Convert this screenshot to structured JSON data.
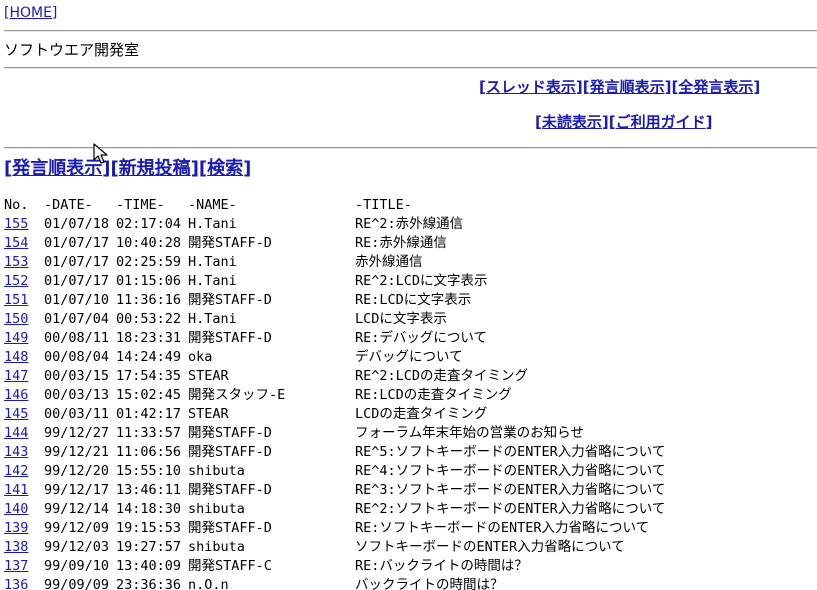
{
  "home": {
    "label": "[HOME]"
  },
  "board_title": "ソフトウエア開発室",
  "top_nav": {
    "row1": [
      "スレッド表示",
      "発言順表示",
      "全発言表示"
    ],
    "row2": [
      "未読表示",
      "ご利用ガイド"
    ]
  },
  "sub_nav": [
    "発言順表示",
    "新規投稿",
    "検索"
  ],
  "brackets": {
    "open": "[",
    "close": "]",
    "sep": "]["
  },
  "list": {
    "headers": {
      "no": "No.",
      "date": "-DATE-",
      "time": "-TIME-",
      "name": "-NAME-",
      "title": "-TITLE-"
    },
    "rows": [
      {
        "no": "155",
        "date": "01/07/18",
        "time": "02:17:04",
        "name": "H.Tani",
        "title": "RE^2:赤外線通信"
      },
      {
        "no": "154",
        "date": "01/07/17",
        "time": "10:40:28",
        "name": "開発STAFF-D",
        "title": "RE:赤外線通信"
      },
      {
        "no": "153",
        "date": "01/07/17",
        "time": "02:25:59",
        "name": "H.Tani",
        "title": "赤外線通信"
      },
      {
        "no": "152",
        "date": "01/07/17",
        "time": "01:15:06",
        "name": "H.Tani",
        "title": "RE^2:LCDに文字表示"
      },
      {
        "no": "151",
        "date": "01/07/10",
        "time": "11:36:16",
        "name": "開発STAFF-D",
        "title": "RE:LCDに文字表示"
      },
      {
        "no": "150",
        "date": "01/07/04",
        "time": "00:53:22",
        "name": "H.Tani",
        "title": "LCDに文字表示"
      },
      {
        "no": "149",
        "date": "00/08/11",
        "time": "18:23:31",
        "name": "開発STAFF-D",
        "title": "RE:デバッグについて"
      },
      {
        "no": "148",
        "date": "00/08/04",
        "time": "14:24:49",
        "name": "oka",
        "title": "デバッグについて"
      },
      {
        "no": "147",
        "date": "00/03/15",
        "time": "17:54:35",
        "name": "STEAR",
        "title": "RE^2:LCDの走査タイミング"
      },
      {
        "no": "146",
        "date": "00/03/13",
        "time": "15:02:45",
        "name": "開発スタッフ-E",
        "title": "RE:LCDの走査タイミング"
      },
      {
        "no": "145",
        "date": "00/03/11",
        "time": "01:42:17",
        "name": "STEAR",
        "title": "LCDの走査タイミング"
      },
      {
        "no": "144",
        "date": "99/12/27",
        "time": "11:33:57",
        "name": "開発STAFF-D",
        "title": "フォーラム年末年始の営業のお知らせ"
      },
      {
        "no": "143",
        "date": "99/12/21",
        "time": "11:06:56",
        "name": "開発STAFF-D",
        "title": "RE^5:ソフトキーボードのENTER入力省略について"
      },
      {
        "no": "142",
        "date": "99/12/20",
        "time": "15:55:10",
        "name": "shibuta",
        "title": "RE^4:ソフトキーボードのENTER入力省略について"
      },
      {
        "no": "141",
        "date": "99/12/17",
        "time": "13:46:11",
        "name": "開発STAFF-D",
        "title": "RE^3:ソフトキーボードのENTER入力省略について"
      },
      {
        "no": "140",
        "date": "99/12/14",
        "time": "14:18:30",
        "name": "shibuta",
        "title": "RE^2:ソフトキーボードのENTER入力省略について"
      },
      {
        "no": "139",
        "date": "99/12/09",
        "time": "19:15:53",
        "name": "開発STAFF-D",
        "title": "RE:ソフトキーボードのENTER入力省略について"
      },
      {
        "no": "138",
        "date": "99/12/03",
        "time": "19:27:57",
        "name": "shibuta",
        "title": "ソフトキーボードのENTER入力省略について"
      },
      {
        "no": "137",
        "date": "99/09/10",
        "time": "13:40:09",
        "name": "開発STAFF-C",
        "title": "RE:バックライトの時間は？"
      },
      {
        "no": "136",
        "date": "99/09/09",
        "time": "23:36:36",
        "name": "n.O.n",
        "title": "バックライトの時間は？"
      }
    ]
  },
  "colors": {
    "link": "#1a1ab4",
    "rule": "#9a9a9a",
    "text": "#000000"
  },
  "icons": {
    "cursor": "mouse-pointer-icon"
  }
}
